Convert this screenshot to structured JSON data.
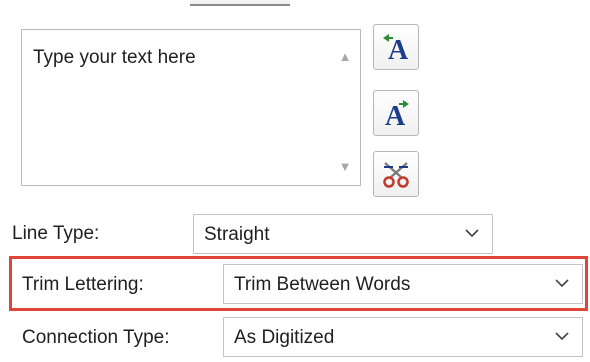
{
  "text_box": {
    "content": "Type your text here"
  },
  "scroll": {
    "up_icon": "triangle-up-icon",
    "down_icon": "triangle-down-icon"
  },
  "tools": [
    {
      "icon": "text-direction-left-icon"
    },
    {
      "icon": "text-direction-right-icon"
    },
    {
      "icon": "scissors-icon"
    }
  ],
  "fields": {
    "line_type": {
      "label": "Line Type:",
      "value": "Straight"
    },
    "trim_lettering": {
      "label": "Trim Lettering:",
      "value": "Trim Between Words"
    },
    "connection_type": {
      "label": "Connection Type:",
      "value": "As Digitized"
    }
  },
  "colors": {
    "highlight": "#e0453a",
    "icon_blue": "#1c3c8c",
    "icon_green": "#2e8b3a",
    "icon_red": "#c0392b"
  }
}
